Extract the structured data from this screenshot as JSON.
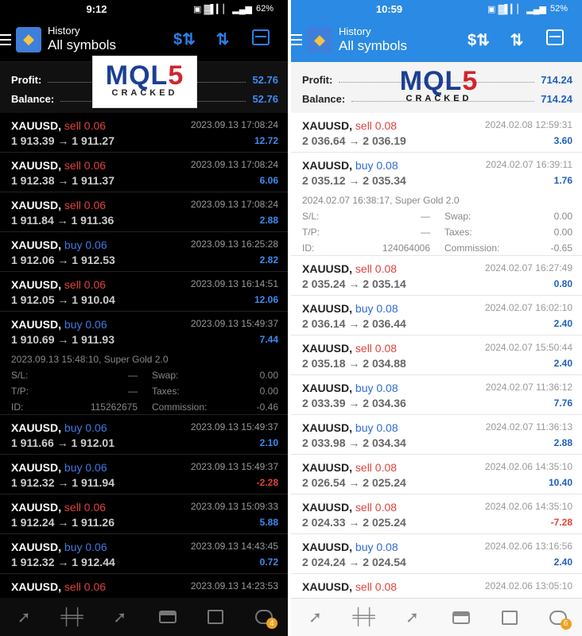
{
  "screens": [
    {
      "id": "dark",
      "status": {
        "time": "9:12",
        "battery": "62%",
        "signal": "▣ ▓▌▎▏ ▂▄▆"
      },
      "header": {
        "subtitle": "History",
        "title": "All symbols"
      },
      "summary": {
        "profit_label": "Profit:",
        "profit": "52.76",
        "balance_label": "Balance:",
        "balance": "52.76"
      },
      "trades": [
        {
          "symbol": "XAUUSD,",
          "side": "sell 0.06",
          "type": "sell",
          "date": "2023.09.13 17:08:24",
          "prices": "1 913.39 → 1 911.27",
          "profit": "12.72",
          "sign": "pos"
        },
        {
          "symbol": "XAUUSD,",
          "side": "sell 0.06",
          "type": "sell",
          "date": "2023.09.13 17:08:24",
          "prices": "1 912.38 → 1 911.37",
          "profit": "6.06",
          "sign": "pos"
        },
        {
          "symbol": "XAUUSD,",
          "side": "sell 0.06",
          "type": "sell",
          "date": "2023.09.13 17:08:24",
          "prices": "1 911.84 → 1 911.36",
          "profit": "2.88",
          "sign": "pos"
        },
        {
          "symbol": "XAUUSD,",
          "side": "buy 0.06",
          "type": "buy",
          "date": "2023.09.13 16:25:28",
          "prices": "1 912.06 → 1 912.53",
          "profit": "2.82",
          "sign": "pos"
        },
        {
          "symbol": "XAUUSD,",
          "side": "sell 0.06",
          "type": "sell",
          "date": "2023.09.13 16:14:51",
          "prices": "1 912.05 → 1 910.04",
          "profit": "12.06",
          "sign": "pos"
        },
        {
          "symbol": "XAUUSD,",
          "side": "buy 0.06",
          "type": "buy",
          "date": "2023.09.13 15:49:37",
          "prices": "1 910.69 → 1 911.93",
          "profit": "7.44",
          "sign": "pos",
          "detail": {
            "open": "2023.09.13 15:48:10, Super Gold 2.0",
            "sl_label": "S/L:",
            "sl": "—",
            "swap_label": "Swap:",
            "swap": "0.00",
            "tp_label": "T/P:",
            "tp": "—",
            "taxes_label": "Taxes:",
            "taxes": "0.00",
            "id_label": "ID:",
            "id": "115262675",
            "commission_label": "Commission:",
            "commission": "-0.46"
          }
        },
        {
          "symbol": "XAUUSD,",
          "side": "buy 0.06",
          "type": "buy",
          "date": "2023.09.13 15:49:37",
          "prices": "1 911.66 → 1 912.01",
          "profit": "2.10",
          "sign": "pos"
        },
        {
          "symbol": "XAUUSD,",
          "side": "buy 0.06",
          "type": "buy",
          "date": "2023.09.13 15:49:37",
          "prices": "1 912.32 → 1 911.94",
          "profit": "-2.28",
          "sign": "neg"
        },
        {
          "symbol": "XAUUSD,",
          "side": "sell 0.06",
          "type": "sell",
          "date": "2023.09.13 15:09:33",
          "prices": "1 912.24 → 1 911.26",
          "profit": "5.88",
          "sign": "pos"
        },
        {
          "symbol": "XAUUSD,",
          "side": "buy 0.06",
          "type": "buy",
          "date": "2023.09.13 14:43:45",
          "prices": "1 912.32 → 1 912.44",
          "profit": "0.72",
          "sign": "pos"
        },
        {
          "symbol": "XAUUSD,",
          "side": "sell 0.06",
          "type": "sell",
          "date": "2023.09.13 14:23:53",
          "prices": "",
          "profit": "",
          "sign": "pos"
        }
      ],
      "nav_badge": "4"
    },
    {
      "id": "light",
      "status": {
        "time": "10:59",
        "battery": "52%",
        "signal": "▣ ▓▌▎▏ ▂▄▆"
      },
      "header": {
        "subtitle": "History",
        "title": "All symbols"
      },
      "summary": {
        "profit_label": "Profit:",
        "profit": "714.24",
        "balance_label": "Balance:",
        "balance": "714.24"
      },
      "trades": [
        {
          "symbol": "XAUUSD,",
          "side": "sell 0.08",
          "type": "sell",
          "date": "2024.02.08 12:59:31",
          "prices": "2 036.64 → 2 036.19",
          "profit": "3.60",
          "sign": "pos"
        },
        {
          "symbol": "XAUUSD,",
          "side": "buy 0.08",
          "type": "buy",
          "date": "2024.02.07 16:39:11",
          "prices": "2 035.12 → 2 035.34",
          "profit": "1.76",
          "sign": "pos",
          "detail": {
            "open": "2024.02.07 16:38:17, Super Gold 2.0",
            "sl_label": "S/L:",
            "sl": "—",
            "swap_label": "Swap:",
            "swap": "0.00",
            "tp_label": "T/P:",
            "tp": "—",
            "taxes_label": "Taxes:",
            "taxes": "0.00",
            "id_label": "ID:",
            "id": "124064006",
            "commission_label": "Commission:",
            "commission": "-0.65"
          }
        },
        {
          "symbol": "XAUUSD,",
          "side": "sell 0.08",
          "type": "sell",
          "date": "2024.02.07 16:27:49",
          "prices": "2 035.24 → 2 035.14",
          "profit": "0.80",
          "sign": "pos"
        },
        {
          "symbol": "XAUUSD,",
          "side": "buy 0.08",
          "type": "buy",
          "date": "2024.02.07 16:02:10",
          "prices": "2 036.14 → 2 036.44",
          "profit": "2.40",
          "sign": "pos"
        },
        {
          "symbol": "XAUUSD,",
          "side": "sell 0.08",
          "type": "sell",
          "date": "2024.02.07 15:50:44",
          "prices": "2 035.18 → 2 034.88",
          "profit": "2.40",
          "sign": "pos"
        },
        {
          "symbol": "XAUUSD,",
          "side": "buy 0.08",
          "type": "buy",
          "date": "2024.02.07 11:36:12",
          "prices": "2 033.39 → 2 034.36",
          "profit": "7.76",
          "sign": "pos"
        },
        {
          "symbol": "XAUUSD,",
          "side": "buy 0.08",
          "type": "buy",
          "date": "2024.02.07 11:36:13",
          "prices": "2 033.98 → 2 034.34",
          "profit": "2.88",
          "sign": "pos"
        },
        {
          "symbol": "XAUUSD,",
          "side": "sell 0.08",
          "type": "sell",
          "date": "2024.02.06 14:35:10",
          "prices": "2 026.54 → 2 025.24",
          "profit": "10.40",
          "sign": "pos"
        },
        {
          "symbol": "XAUUSD,",
          "side": "sell 0.08",
          "type": "sell",
          "date": "2024.02.06 14:35:10",
          "prices": "2 024.33 → 2 025.24",
          "profit": "-7.28",
          "sign": "neg"
        },
        {
          "symbol": "XAUUSD,",
          "side": "buy 0.08",
          "type": "buy",
          "date": "2024.02.06 13:16:56",
          "prices": "2 024.24 → 2 024.54",
          "profit": "2.40",
          "sign": "pos"
        },
        {
          "symbol": "XAUUSD,",
          "side": "sell 0.08",
          "type": "sell",
          "date": "2024.02.06 13:05:10",
          "prices": "",
          "profit": "",
          "sign": "pos"
        }
      ],
      "nav_badge": "6"
    }
  ],
  "watermark": {
    "part1": "MQL",
    "part2": "5",
    "sub": "CRACKED"
  },
  "colors": {
    "sell": "#e0423c",
    "buy": "#3f78e0",
    "accent": "#2f7fe8",
    "header_light": "#2b8ae3"
  },
  "nav_icons": [
    "trade-icon",
    "chart-icon",
    "history-icon",
    "inbox-icon",
    "news-icon",
    "chat-icon"
  ]
}
